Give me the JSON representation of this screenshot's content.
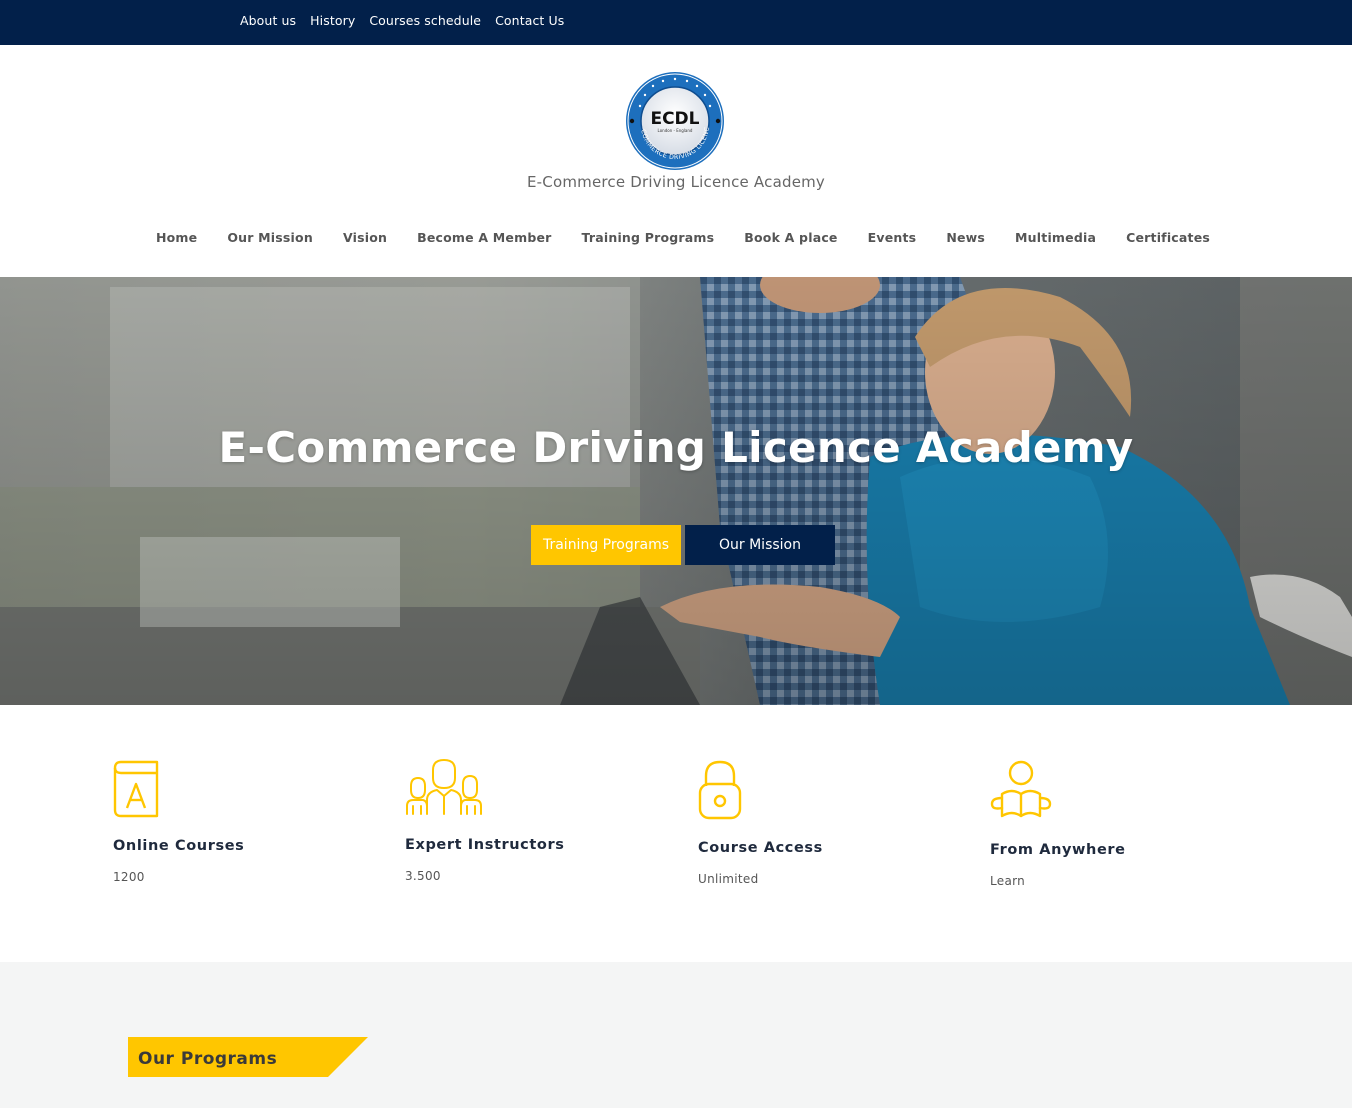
{
  "topbar": {
    "links": [
      "About us",
      "History",
      "Courses schedule",
      "Contact Us"
    ]
  },
  "header": {
    "logo_text": "ECDL",
    "logo_subtext": "London - England",
    "logo_ring_text": "E-COMMERCE DRIVING LICENCE",
    "site_title": "E-Commerce Driving Licence Academy"
  },
  "nav": {
    "items": [
      "Home",
      "Our Mission",
      "Vision",
      "Become A Member",
      "Training Programs",
      "Book A place",
      "Events",
      "News",
      "Multimedia",
      "Certificates"
    ]
  },
  "hero": {
    "title": "E-Commerce Driving Licence Academy",
    "primary_button": "Training Programs",
    "secondary_button": "Our Mission"
  },
  "features": [
    {
      "icon": "book-icon",
      "title": "Online Courses",
      "value": "1200"
    },
    {
      "icon": "instructors-icon",
      "title": "Expert Instructors",
      "value": "3.500"
    },
    {
      "icon": "lock-icon",
      "title": "Course Access",
      "value": "Unlimited"
    },
    {
      "icon": "reader-icon",
      "title": "From Anywhere",
      "value": "Learn"
    }
  ],
  "programs": {
    "heading": "Our Programs"
  },
  "colors": {
    "navy": "#02204a",
    "yellow": "#ffc600",
    "logo_blue": "#1d6fbd"
  }
}
